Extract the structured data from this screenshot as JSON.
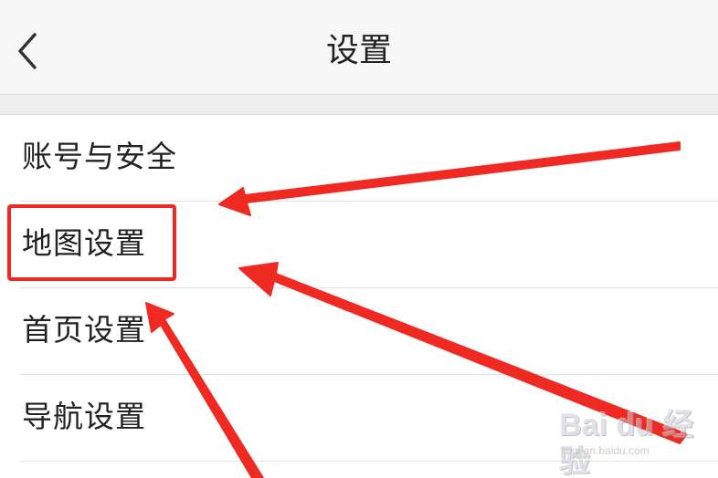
{
  "header": {
    "title": "设置"
  },
  "menu": {
    "items": [
      {
        "label": "账号与安全"
      },
      {
        "label": "地图设置"
      },
      {
        "label": "首页设置"
      },
      {
        "label": "导航设置"
      }
    ]
  },
  "annotation": {
    "highlighted_item": "地图设置",
    "color": "#ee2a22"
  },
  "watermark": {
    "logo_text": "Bai du 经验",
    "url": "jingyan.baidu.com"
  },
  "icons": {
    "back": "chevron-left-icon"
  }
}
